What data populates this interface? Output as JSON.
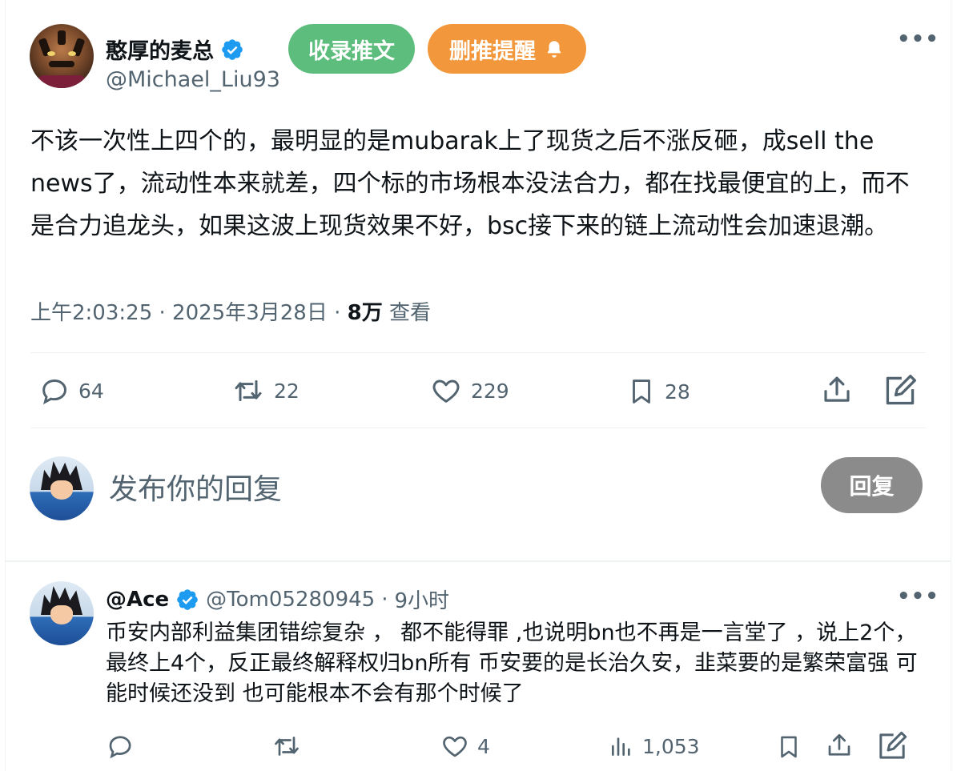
{
  "tweet": {
    "display_name": "憨厚的麦总",
    "handle": "@Michael_Liu93",
    "collect_button": "收录推文",
    "delete_alert_button": "删推提醒",
    "more_label": "•••",
    "text": "不该一次性上四个的，最明显的是mubarak上了现货之后不涨反砸，成sell the news了，流动性本来就差，四个标的市场根本没法合力，都在找最便宜的上，而不是合力追龙头，如果这波上现货效果不好，bsc接下来的链上流动性会加速退潮。",
    "time": "上午2:03:25",
    "date": "2025年3月28日",
    "separator": "·",
    "views_count": "8万",
    "views_label": "查看",
    "stats": {
      "replies": "64",
      "retweets": "22",
      "likes": "229",
      "bookmarks": "28"
    }
  },
  "composer": {
    "placeholder": "发布你的回复",
    "button": "回复"
  },
  "reply": {
    "display_name": "@Ace",
    "handle": "@Tom05280945",
    "separator": "·",
    "time_ago": "9小时",
    "more_label": "•••",
    "text": "币安内部利益集团错综复杂 ， 都不能得罪 ,也说明bn也不再是一言堂了 ，说上2个，最终上4个，反正最终解释权归bn所有 币安要的是长治久安，韭菜要的是繁荣富强 可能时候还没到 也可能根本不会有那个时候了",
    "stats": {
      "likes": "4",
      "views": "1,053"
    }
  },
  "colors": {
    "verified_blue": "#1d9bf0",
    "pill_green": "#5dbd7c",
    "pill_orange": "#f2973b",
    "muted_text": "#536471",
    "reply_button_gray": "#8b8b8b"
  },
  "icons": [
    "verified-badge-icon",
    "bell-icon",
    "more-icon",
    "reply-icon",
    "retweet-icon",
    "like-icon",
    "bookmark-icon",
    "share-icon",
    "edit-icon",
    "views-icon"
  ]
}
